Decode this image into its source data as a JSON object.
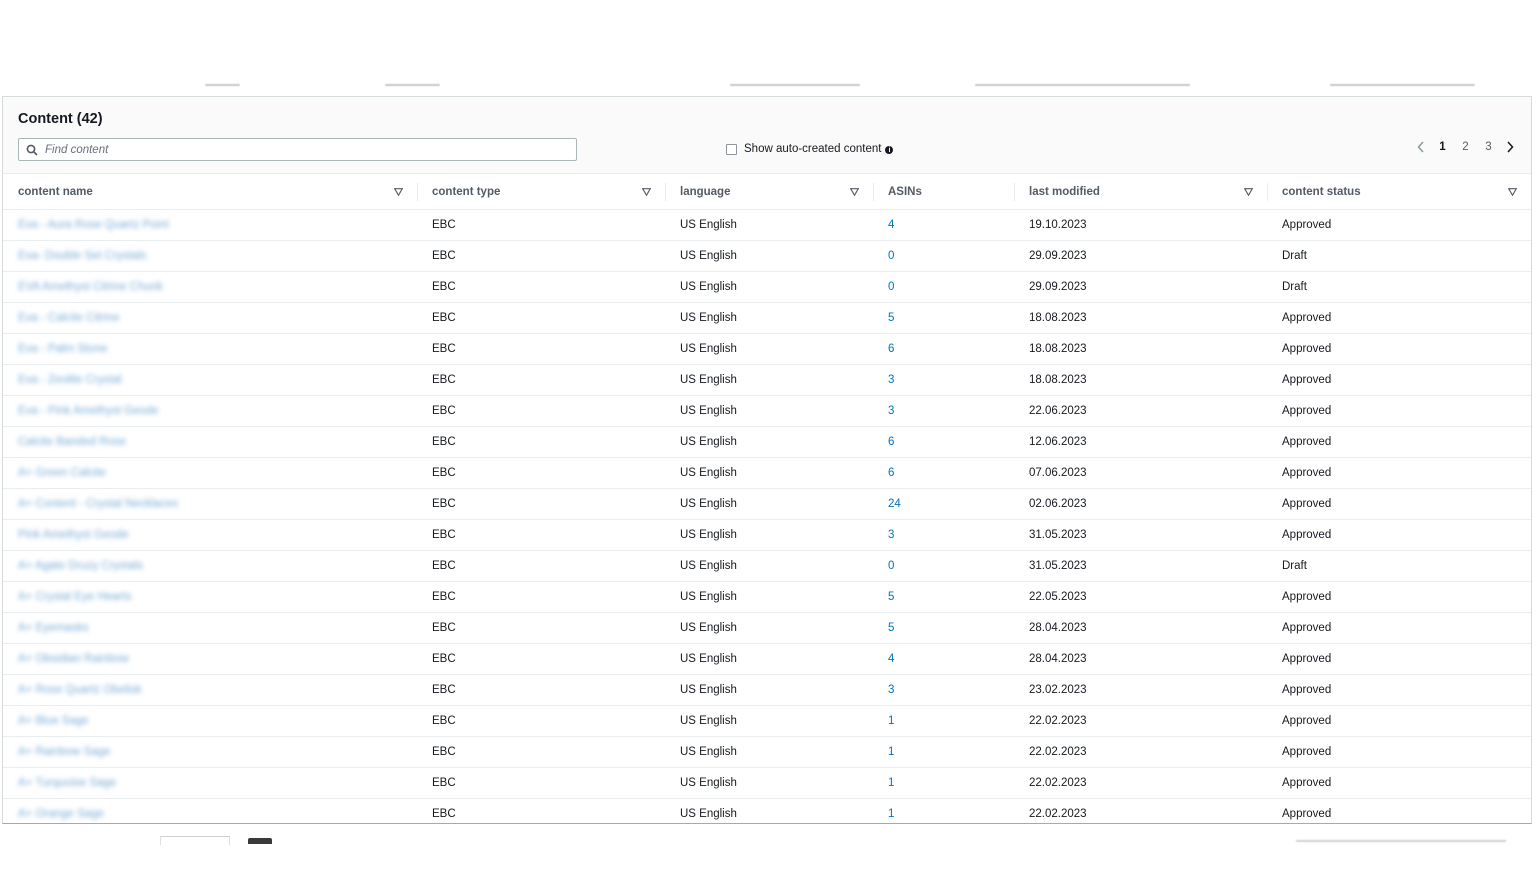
{
  "panel": {
    "title": "Content (42)",
    "search_placeholder": "Find content",
    "auto_created_label": "Show auto-created content",
    "pagination": {
      "pages": [
        "1",
        "2",
        "3"
      ],
      "current": "1"
    }
  },
  "table": {
    "columns": [
      "content name",
      "content type",
      "language",
      "ASINs",
      "last modified",
      "content status"
    ],
    "rows": [
      {
        "name": "Eva - Aura Rose Quartz Point",
        "type": "EBC",
        "language": "US English",
        "asins": "4",
        "modified": "19.10.2023",
        "status": "Approved"
      },
      {
        "name": "Eva- Double Set Crystals",
        "type": "EBC",
        "language": "US English",
        "asins": "0",
        "modified": "29.09.2023",
        "status": "Draft"
      },
      {
        "name": "EVA Amethyst Citrine Chunk",
        "type": "EBC",
        "language": "US English",
        "asins": "0",
        "modified": "29.09.2023",
        "status": "Draft"
      },
      {
        "name": "Eva - Calcite Citrine",
        "type": "EBC",
        "language": "US English",
        "asins": "5",
        "modified": "18.08.2023",
        "status": "Approved"
      },
      {
        "name": "Eva - Palm Stone",
        "type": "EBC",
        "language": "US English",
        "asins": "6",
        "modified": "18.08.2023",
        "status": "Approved"
      },
      {
        "name": "Eva - Zeolite Crystal",
        "type": "EBC",
        "language": "US English",
        "asins": "3",
        "modified": "18.08.2023",
        "status": "Approved"
      },
      {
        "name": "Eva - Pink Amethyst Geode",
        "type": "EBC",
        "language": "US English",
        "asins": "3",
        "modified": "22.06.2023",
        "status": "Approved"
      },
      {
        "name": "Calcite Banded Rose",
        "type": "EBC",
        "language": "US English",
        "asins": "6",
        "modified": "12.06.2023",
        "status": "Approved"
      },
      {
        "name": "A+ Green Calcite",
        "type": "EBC",
        "language": "US English",
        "asins": "6",
        "modified": "07.06.2023",
        "status": "Approved"
      },
      {
        "name": "A+ Content - Crystal Necklaces",
        "type": "EBC",
        "language": "US English",
        "asins": "24",
        "modified": "02.06.2023",
        "status": "Approved"
      },
      {
        "name": "Pink Amethyst Geode",
        "type": "EBC",
        "language": "US English",
        "asins": "3",
        "modified": "31.05.2023",
        "status": "Approved"
      },
      {
        "name": "A+ Agate Druzy Crystals",
        "type": "EBC",
        "language": "US English",
        "asins": "0",
        "modified": "31.05.2023",
        "status": "Draft"
      },
      {
        "name": "A+ Crystal Eye Hearts",
        "type": "EBC",
        "language": "US English",
        "asins": "5",
        "modified": "22.05.2023",
        "status": "Approved"
      },
      {
        "name": "A+ Eyemasks",
        "type": "EBC",
        "language": "US English",
        "asins": "5",
        "modified": "28.04.2023",
        "status": "Approved"
      },
      {
        "name": "A+ Obsidian Rainbow",
        "type": "EBC",
        "language": "US English",
        "asins": "4",
        "modified": "28.04.2023",
        "status": "Approved"
      },
      {
        "name": "A+ Rose Quartz Obelisk",
        "type": "EBC",
        "language": "US English",
        "asins": "3",
        "modified": "23.02.2023",
        "status": "Approved"
      },
      {
        "name": "A+ Blue Sage",
        "type": "EBC",
        "language": "US English",
        "asins": "1",
        "modified": "22.02.2023",
        "status": "Approved"
      },
      {
        "name": "A+ Rainbow Sage",
        "type": "EBC",
        "language": "US English",
        "asins": "1",
        "modified": "22.02.2023",
        "status": "Approved"
      },
      {
        "name": "A+ Turquoise Sage",
        "type": "EBC",
        "language": "US English",
        "asins": "1",
        "modified": "22.02.2023",
        "status": "Approved"
      },
      {
        "name": "A+ Orange Sage",
        "type": "EBC",
        "language": "US English",
        "asins": "1",
        "modified": "22.02.2023",
        "status": "Approved"
      }
    ]
  },
  "colors": {
    "link": "#0073bb",
    "text": "#16191f",
    "header_text": "#545b64",
    "border": "#eaeded"
  },
  "icons": {
    "search": "search-icon",
    "sort": "sort-triangle-icon",
    "info": "info-icon",
    "prev": "chevron-left-icon",
    "next": "chevron-right-icon"
  }
}
